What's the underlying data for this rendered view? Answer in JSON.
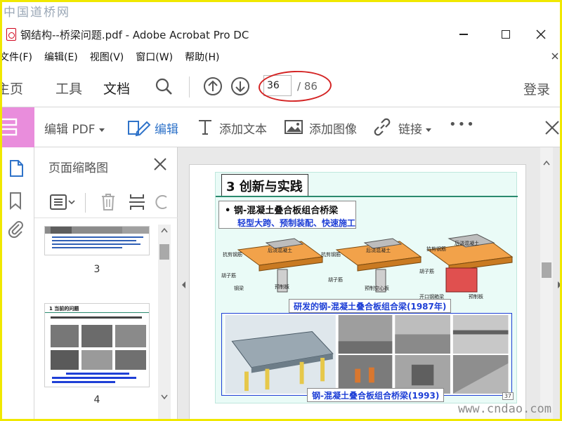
{
  "watermarks": {
    "top": "中国道桥网",
    "bottom": "www.cndao.com"
  },
  "window": {
    "title": "钢结构--桥梁问题.pdf - Adobe Acrobat Pro DC"
  },
  "menu": [
    "文件(F)",
    "编辑(E)",
    "视图(V)",
    "窗口(W)",
    "帮助(H)"
  ],
  "toolbar": {
    "tabs": [
      "主页",
      "工具",
      "文档"
    ],
    "current_page": "36",
    "total_pages": "/ 86",
    "login": "登录"
  },
  "edit_toolbar": {
    "edit_pdf": "编辑 PDF",
    "edit": "编辑",
    "add_text": "添加文本",
    "add_image": "添加图像",
    "link": "链接",
    "more": "•••"
  },
  "thumbnails": {
    "title": "页面缩略图",
    "pages": [
      {
        "label": "3"
      },
      {
        "label": "4",
        "heading": "1 当前的问题"
      }
    ]
  },
  "slide": {
    "title": "3 创新与实践",
    "bullet": "• 钢-混凝土叠合板组合桥梁",
    "subtitle": "轻型大跨、预制装配、快速施工",
    "diagram_labels": {
      "a": "抗剪钢筋",
      "b": "后浇混凝土",
      "c": "胡子筋",
      "d": "钢梁",
      "e": "预制板",
      "f": "预制空心板",
      "g": "开口钢箱梁"
    },
    "caption1": "研发的钢-混凝土叠合板组合梁(1987年)",
    "caption2": "钢-混凝土叠合板组合桥梁(1993)",
    "page_number": "37"
  },
  "colors": {
    "accent_pink": "#e98ddc",
    "accent_blue": "#2f73c9",
    "highlight_red": "#d42424",
    "frame_yellow": "#f0e800"
  }
}
